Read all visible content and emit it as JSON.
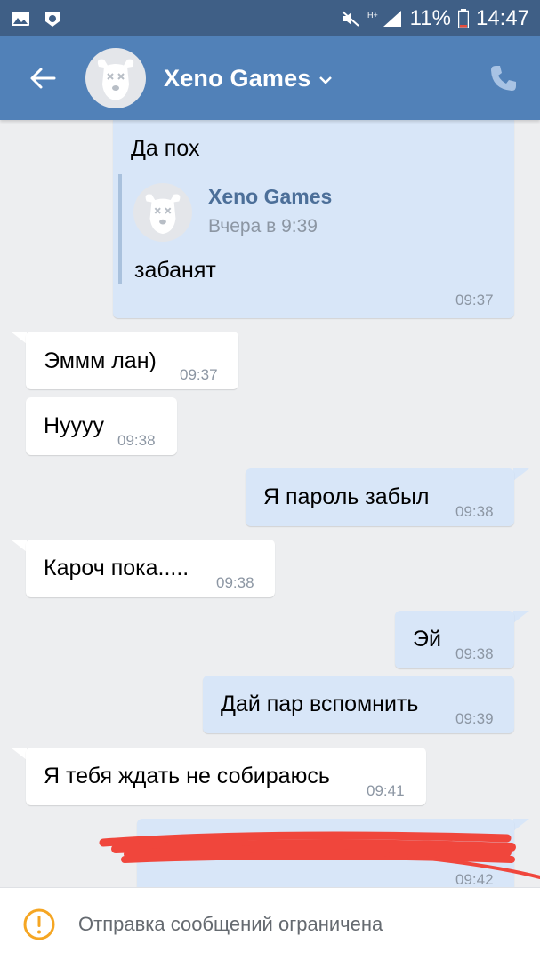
{
  "status_bar": {
    "battery": "11%",
    "time": "14:47"
  },
  "header": {
    "chat_name": "Xeno Games"
  },
  "forwarded_message": {
    "text": "Да пох",
    "fwd_name": "Xeno Games",
    "fwd_date": "Вчера в 9:39",
    "fwd_text": "забанят",
    "time": "09:37"
  },
  "messages": [
    {
      "dir": "in",
      "text": "Эммм лан)",
      "time": "09:37"
    },
    {
      "dir": "in",
      "text": "Нуууу",
      "time": "09:38"
    },
    {
      "dir": "out",
      "text": "Я пароль забыл",
      "time": "09:38"
    },
    {
      "dir": "in",
      "text": "Кароч пока.....",
      "time": "09:38"
    },
    {
      "dir": "out",
      "text": "Эй",
      "time": "09:38"
    },
    {
      "dir": "out",
      "text": "Дай пар вспомнить",
      "time": "09:39"
    },
    {
      "dir": "in",
      "text": "Я тебя ждать не собираюсь",
      "time": "09:41"
    },
    {
      "dir": "out",
      "text": "",
      "time": "09:42"
    }
  ],
  "bottom_bar": {
    "notice": "Отправка сообщений ограничена"
  },
  "colors": {
    "header": "#5181b8",
    "status_bar": "#3f5f86",
    "background": "#edeef0",
    "outgoing_bubble": "#d8e6f8",
    "incoming_bubble": "#ffffff",
    "warning": "#f5a623",
    "scribble": "#f0463c"
  },
  "icons": [
    "gallery-icon",
    "vk-icon",
    "mute-icon",
    "signal-icon",
    "battery-icon",
    "back-arrow-icon",
    "chevron-down-icon",
    "phone-icon",
    "warning-icon"
  ]
}
